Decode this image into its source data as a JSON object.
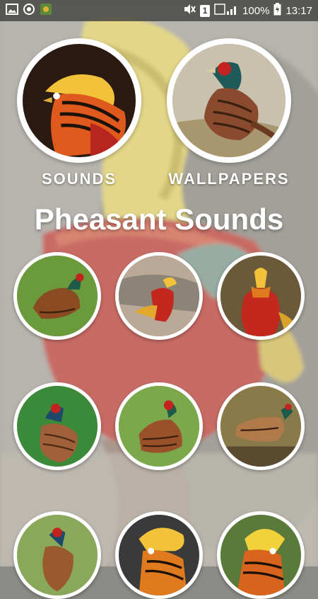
{
  "status_bar": {
    "battery": "100%",
    "time": "13:17",
    "sim_label": "1"
  },
  "features": {
    "sounds_label": "SOUNDS",
    "wallpapers_label": "WALLPAPERS"
  },
  "title": "Pheasant Sounds",
  "colors": {
    "accent_white": "#ffffff",
    "status_bar": "#3c3c3a"
  },
  "thumbnails": [
    {
      "subject": "common-pheasant-on-grass"
    },
    {
      "subject": "golden-pheasant-on-rock"
    },
    {
      "subject": "golden-pheasant-front"
    },
    {
      "subject": "ringneck-pheasant-in-grass"
    },
    {
      "subject": "common-pheasant-standing"
    },
    {
      "subject": "pheasant-hen-on-log"
    },
    {
      "subject": "pheasant-in-meadow"
    },
    {
      "subject": "golden-pheasant-head"
    },
    {
      "subject": "golden-pheasant-portrait"
    }
  ]
}
